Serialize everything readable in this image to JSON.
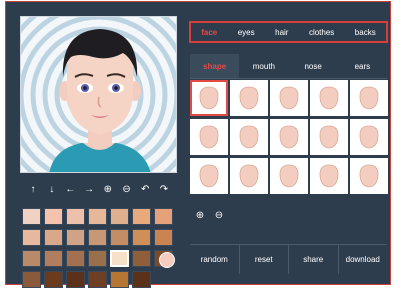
{
  "toolbar": {
    "icons": [
      "arrow-up",
      "arrow-down",
      "arrow-left",
      "arrow-right",
      "zoom-in",
      "zoom-out",
      "undo",
      "redo"
    ],
    "glyphs": [
      "↑",
      "↓",
      "←",
      "→",
      "⊕",
      "⊖",
      "↶",
      "↷"
    ]
  },
  "swatches": {
    "colors": [
      "#f0d2c4",
      "#f4c3ad",
      "#ecc0aa",
      "#e7b799",
      "#deb08e",
      "#e8a97c",
      "#e4a17a",
      "#e6b99e",
      "#d9a88b",
      "#d0a386",
      "#c89776",
      "#c58d65",
      "#cf8f58",
      "#c98451",
      "#b88a6a",
      "#b07e5e",
      "#a3714f",
      "#9a6f4c",
      "#f6e0c8",
      "#8f5f3c",
      "#7c4c28",
      "#8b5a3b",
      "#6b3b1e",
      "#5b311a",
      "#6e3f22",
      "#b67634",
      "#5a3219"
    ],
    "selected_index": 18,
    "current_color": "#f3cdbf"
  },
  "categories": {
    "items": [
      "face",
      "eyes",
      "hair",
      "clothes",
      "backs"
    ],
    "active": "face"
  },
  "subtabs": {
    "items": [
      "shape",
      "mouth",
      "nose",
      "ears"
    ],
    "active": "shape"
  },
  "grid": {
    "item_count": 15,
    "selected_index": 0,
    "skin": "#f3cdbf",
    "skin_stroke": "#d9a998"
  },
  "zoom": {
    "icons": [
      "zoom-in",
      "zoom-out"
    ],
    "glyphs": [
      "⊕",
      "⊖"
    ]
  },
  "actions": {
    "random": "random",
    "reset": "reset",
    "share": "share",
    "download": "download"
  }
}
